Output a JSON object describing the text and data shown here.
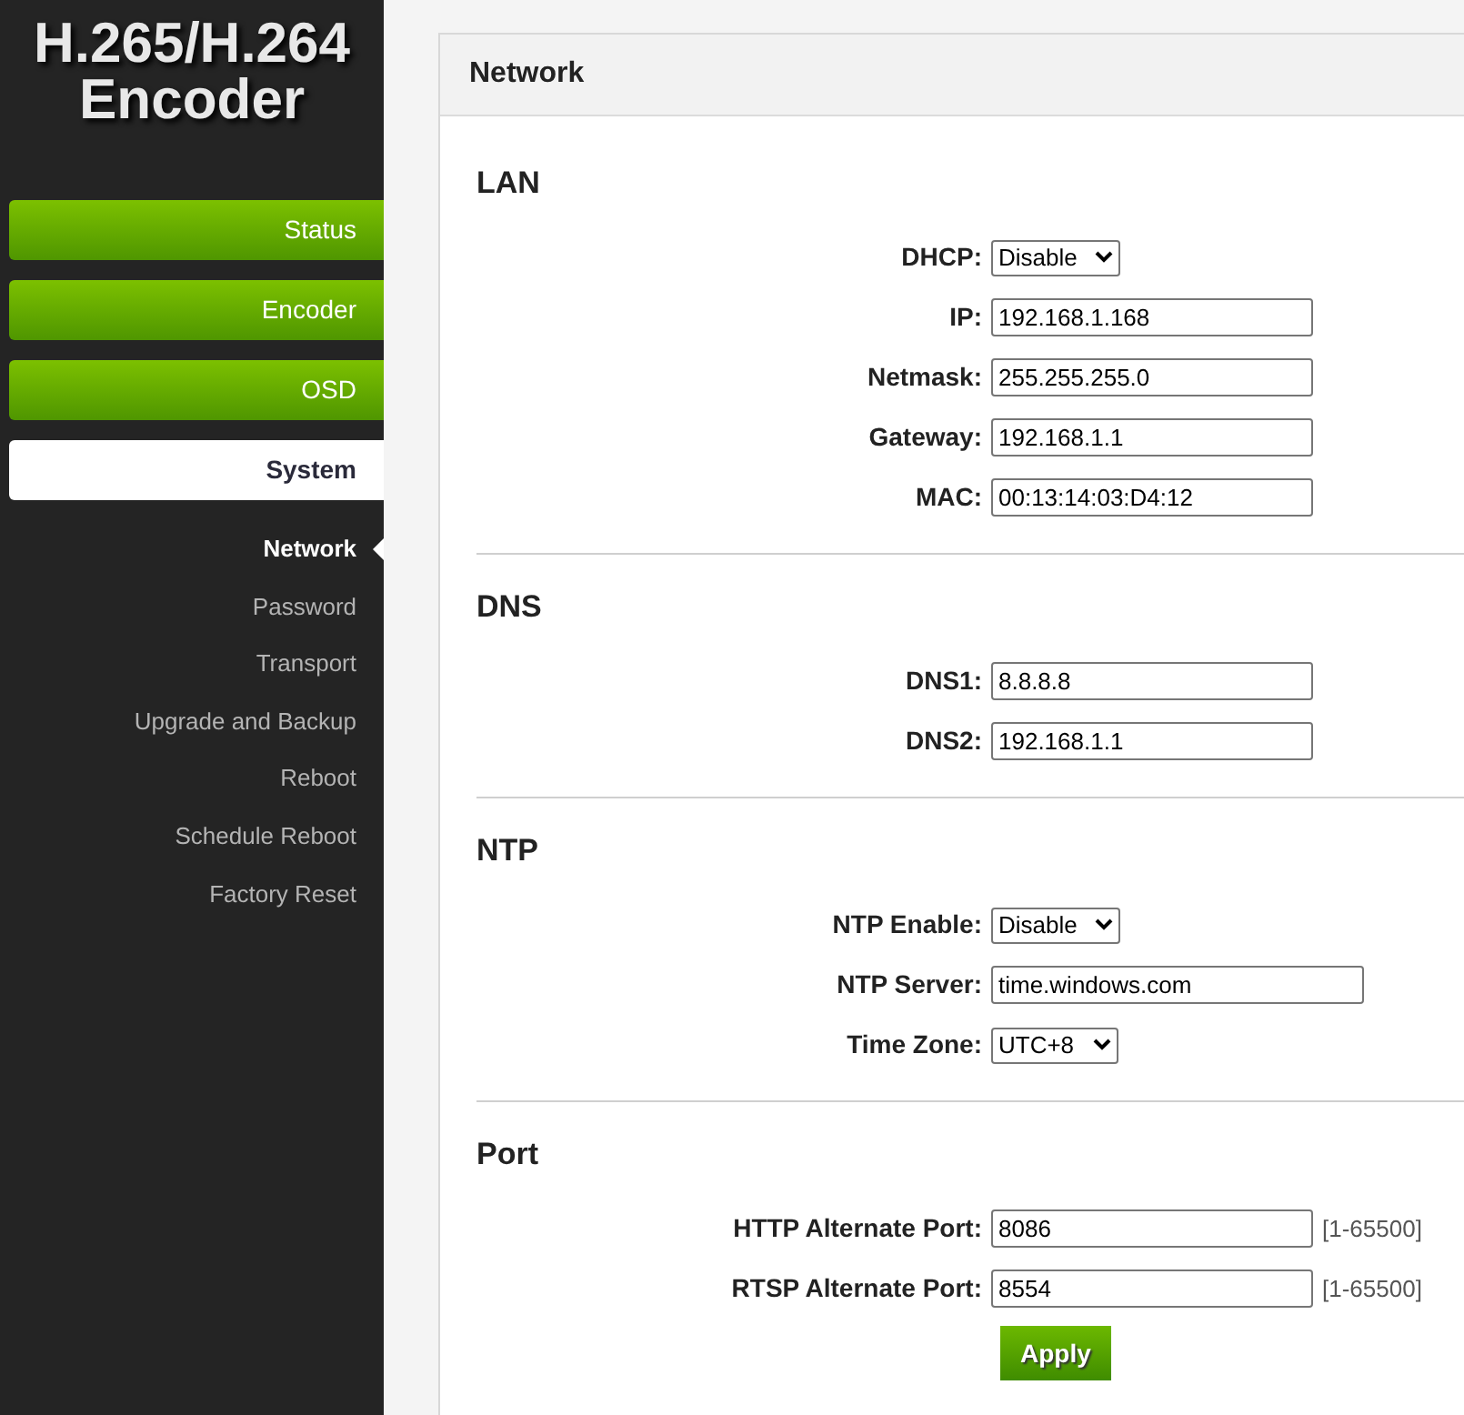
{
  "sidebar": {
    "title_lines": [
      "H.265/H.264",
      "Encoder"
    ],
    "items": [
      {
        "label": "Status",
        "kind": "main",
        "selected": false
      },
      {
        "label": "Encoder",
        "kind": "main",
        "selected": false
      },
      {
        "label": "OSD",
        "kind": "main",
        "selected": false
      },
      {
        "label": "System",
        "kind": "main",
        "selected": true
      },
      {
        "label": "Network",
        "kind": "sub",
        "selected": true
      },
      {
        "label": "Password",
        "kind": "sub",
        "selected": false
      },
      {
        "label": "Transport",
        "kind": "sub",
        "selected": false
      },
      {
        "label": "Upgrade and Backup",
        "kind": "sub",
        "selected": false
      },
      {
        "label": "Reboot",
        "kind": "sub",
        "selected": false
      },
      {
        "label": "Schedule Reboot",
        "kind": "sub",
        "selected": false
      },
      {
        "label": "Factory Reset",
        "kind": "sub",
        "selected": false
      }
    ]
  },
  "panel": {
    "title": "Network",
    "sections": [
      {
        "heading": "LAN",
        "fields": [
          {
            "label": "DHCP:",
            "kind": "select",
            "value": "Disable"
          },
          {
            "label": "IP:",
            "kind": "text",
            "value": "192.168.1.168"
          },
          {
            "label": "Netmask:",
            "kind": "text",
            "value": "255.255.255.0"
          },
          {
            "label": "Gateway:",
            "kind": "text",
            "value": "192.168.1.1"
          },
          {
            "label": "MAC:",
            "kind": "text",
            "value": "00:13:14:03:D4:12"
          }
        ]
      },
      {
        "heading": "DNS",
        "fields": [
          {
            "label": "DNS1:",
            "kind": "text",
            "value": "8.8.8.8"
          },
          {
            "label": "DNS2:",
            "kind": "text",
            "value": "192.168.1.1"
          }
        ]
      },
      {
        "heading": "NTP",
        "fields": [
          {
            "label": "NTP Enable:",
            "kind": "select",
            "value": "Disable"
          },
          {
            "label": "NTP Server:",
            "kind": "wide",
            "value": "time.windows.com"
          },
          {
            "label": "Time Zone:",
            "kind": "select",
            "value": "UTC+8"
          }
        ]
      },
      {
        "heading": "Port",
        "fields": [
          {
            "label": "HTTP Alternate Port:",
            "kind": "text",
            "value": "8086",
            "hint": "[1-65500]"
          },
          {
            "label": "RTSP Alternate Port:",
            "kind": "text",
            "value": "8554",
            "hint": "[1-65500]"
          }
        ],
        "button": "Apply"
      }
    ]
  }
}
